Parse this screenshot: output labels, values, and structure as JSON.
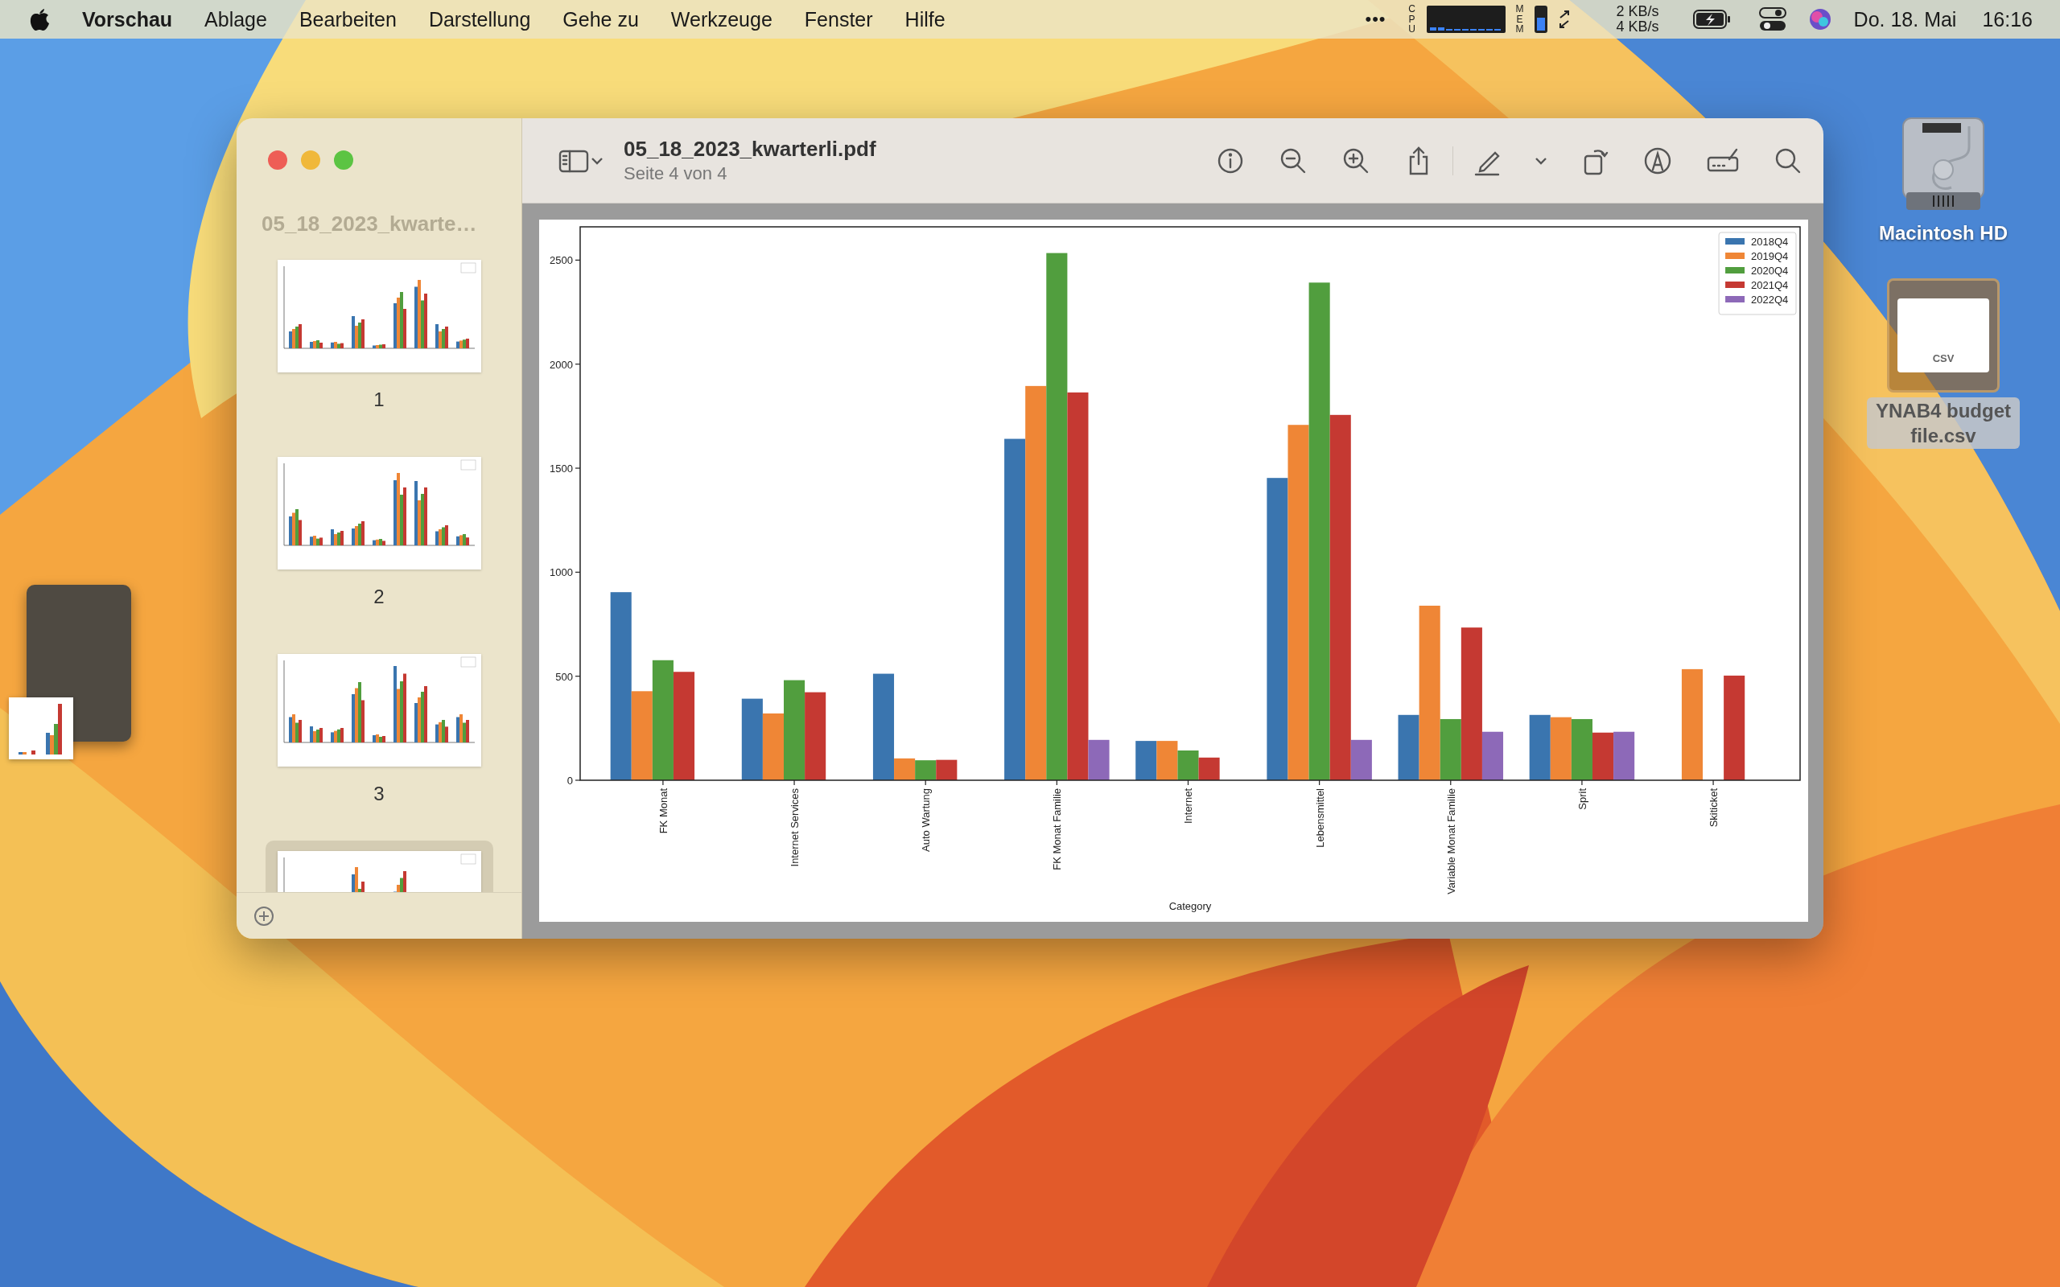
{
  "menu_bar": {
    "app_name": "Vorschau",
    "menus": [
      "Ablage",
      "Bearbeiten",
      "Darstellung",
      "Gehe zu",
      "Werkzeuge",
      "Fenster",
      "Hilfe"
    ],
    "status": {
      "more": "•••",
      "cpu_label": "CPU",
      "mem_label": "MEM",
      "mem": {
        "level": 0.55
      },
      "net_up": "2 KB/s",
      "net_down": "4 KB/s",
      "date": "Do. 18. Mai",
      "time": "16:16"
    }
  },
  "desktop_icons": [
    {
      "kind": "drive",
      "label": "Macintosh HD",
      "selected": false
    },
    {
      "kind": "csv",
      "label": "YNAB4 budget file.csv",
      "badge": "CSV",
      "selected": true
    }
  ],
  "window": {
    "title": "05_18_2023_kwarterli.pdf",
    "subtitle": "Seite 4 von 4",
    "sidebar": {
      "title": "05_18_2023_kwarte…",
      "pages": [
        {
          "label": "1",
          "selected": false
        },
        {
          "label": "2",
          "selected": false
        },
        {
          "label": "3",
          "selected": false
        },
        {
          "selected": true
        }
      ]
    },
    "document": {
      "chart_data": {
        "type": "bar",
        "xlabel": "Category",
        "categories": [
          "FK Monat",
          "Internet Services",
          "Auto Wartung",
          "FK Monat Familie",
          "Internet",
          "Lebensmittel",
          "Variable Monat Familie",
          "Sprit",
          "Skiticket"
        ],
        "series": [
          {
            "name": "2018Q4",
            "color": "#3a75af",
            "values": [
              904,
              392,
              512,
              1641,
              189,
              1453,
              314,
              314,
              null
            ]
          },
          {
            "name": "2019Q4",
            "color": "#ef8636",
            "values": [
              428,
              321,
              105,
              1895,
              189,
              1708,
              839,
              303,
              534
            ]
          },
          {
            "name": "2020Q4",
            "color": "#519e3e",
            "values": [
              577,
              481,
              96,
              2534,
              143,
              2392,
              294,
              294,
              null
            ]
          },
          {
            "name": "2021Q4",
            "color": "#c53932",
            "values": [
              521,
              423,
              98,
              1864,
              109,
              1756,
              734,
              229,
              503
            ]
          },
          {
            "name": "2022Q4",
            "color": "#8d69b8",
            "values": [
              null,
              null,
              null,
              194,
              null,
              194,
              233,
              233,
              null
            ]
          }
        ],
        "legend": "upper right",
        "ylim": [
          0,
          2660
        ],
        "yticks": [
          0,
          500,
          1000,
          1500,
          2000,
          2500
        ]
      }
    }
  }
}
